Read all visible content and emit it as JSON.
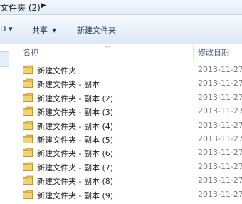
{
  "address": {
    "path_label": "文件夹 (2)"
  },
  "commandbar": {
    "left_fragment": "D ▾",
    "share_label": "共享",
    "new_folder_label": "新建文件夹"
  },
  "columns": {
    "name_label": "名称",
    "date_label": "修改日期"
  },
  "files": [
    {
      "name": "新建文件夹",
      "date": "2013-11-27"
    },
    {
      "name": "新建文件夹 - 副本",
      "date": "2013-11-27"
    },
    {
      "name": "新建文件夹 - 副本 (2)",
      "date": "2013-11-27"
    },
    {
      "name": "新建文件夹 - 副本 (3)",
      "date": "2013-11-27"
    },
    {
      "name": "新建文件夹 - 副本 (4)",
      "date": "2013-11-27"
    },
    {
      "name": "新建文件夹 - 副本 (5)",
      "date": "2013-11-27"
    },
    {
      "name": "新建文件夹 - 副本 (6)",
      "date": "2013-11-27"
    },
    {
      "name": "新建文件夹 - 副本 (7)",
      "date": "2013-11-27"
    },
    {
      "name": "新建文件夹 - 副本 (8)",
      "date": "2013-11-27"
    },
    {
      "name": "新建文件夹 - 副本 (9)",
      "date": "2013-11-27"
    }
  ],
  "icons": {
    "folder": "folder-icon",
    "breadcrumb_arrow": "chevron-right-icon",
    "dropdown": "chevron-down-icon",
    "sort": "sort-ascending-icon"
  },
  "colors": {
    "folder_fill": "#e8c15a",
    "folder_edge": "#b98e22",
    "command_text": "#1e3a5c"
  }
}
